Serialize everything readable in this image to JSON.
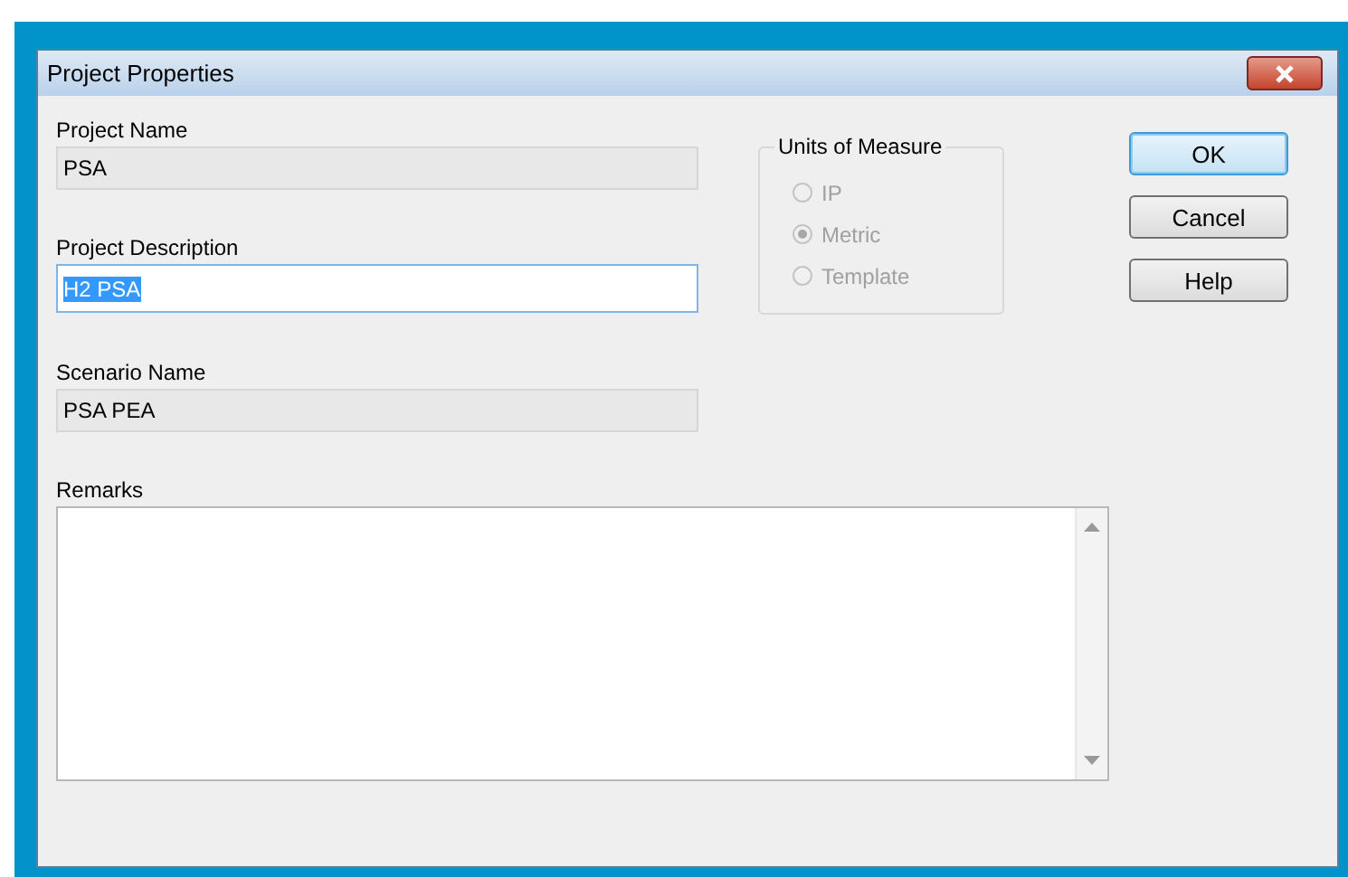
{
  "window": {
    "title": "Project Properties"
  },
  "fields": [
    {
      "label": "Project Name",
      "value": "PSA",
      "disabled": true,
      "text_selected": false
    },
    {
      "label": "Project Description",
      "value": "H2 PSA",
      "disabled": false,
      "text_selected": true
    },
    {
      "label": "Scenario Name",
      "value": "PSA PEA",
      "disabled": true,
      "text_selected": false
    }
  ],
  "units_of_measure": {
    "title": "Units of Measure",
    "options": [
      {
        "label": "IP",
        "selected": false,
        "disabled": true
      },
      {
        "label": "Metric",
        "selected": true,
        "disabled": true
      },
      {
        "label": "Template",
        "selected": false,
        "disabled": true
      }
    ]
  },
  "buttons": [
    {
      "label": "OK",
      "default": true
    },
    {
      "label": "Cancel",
      "default": false
    },
    {
      "label": "Help",
      "default": false
    }
  ],
  "remarks": {
    "label": "Remarks"
  }
}
